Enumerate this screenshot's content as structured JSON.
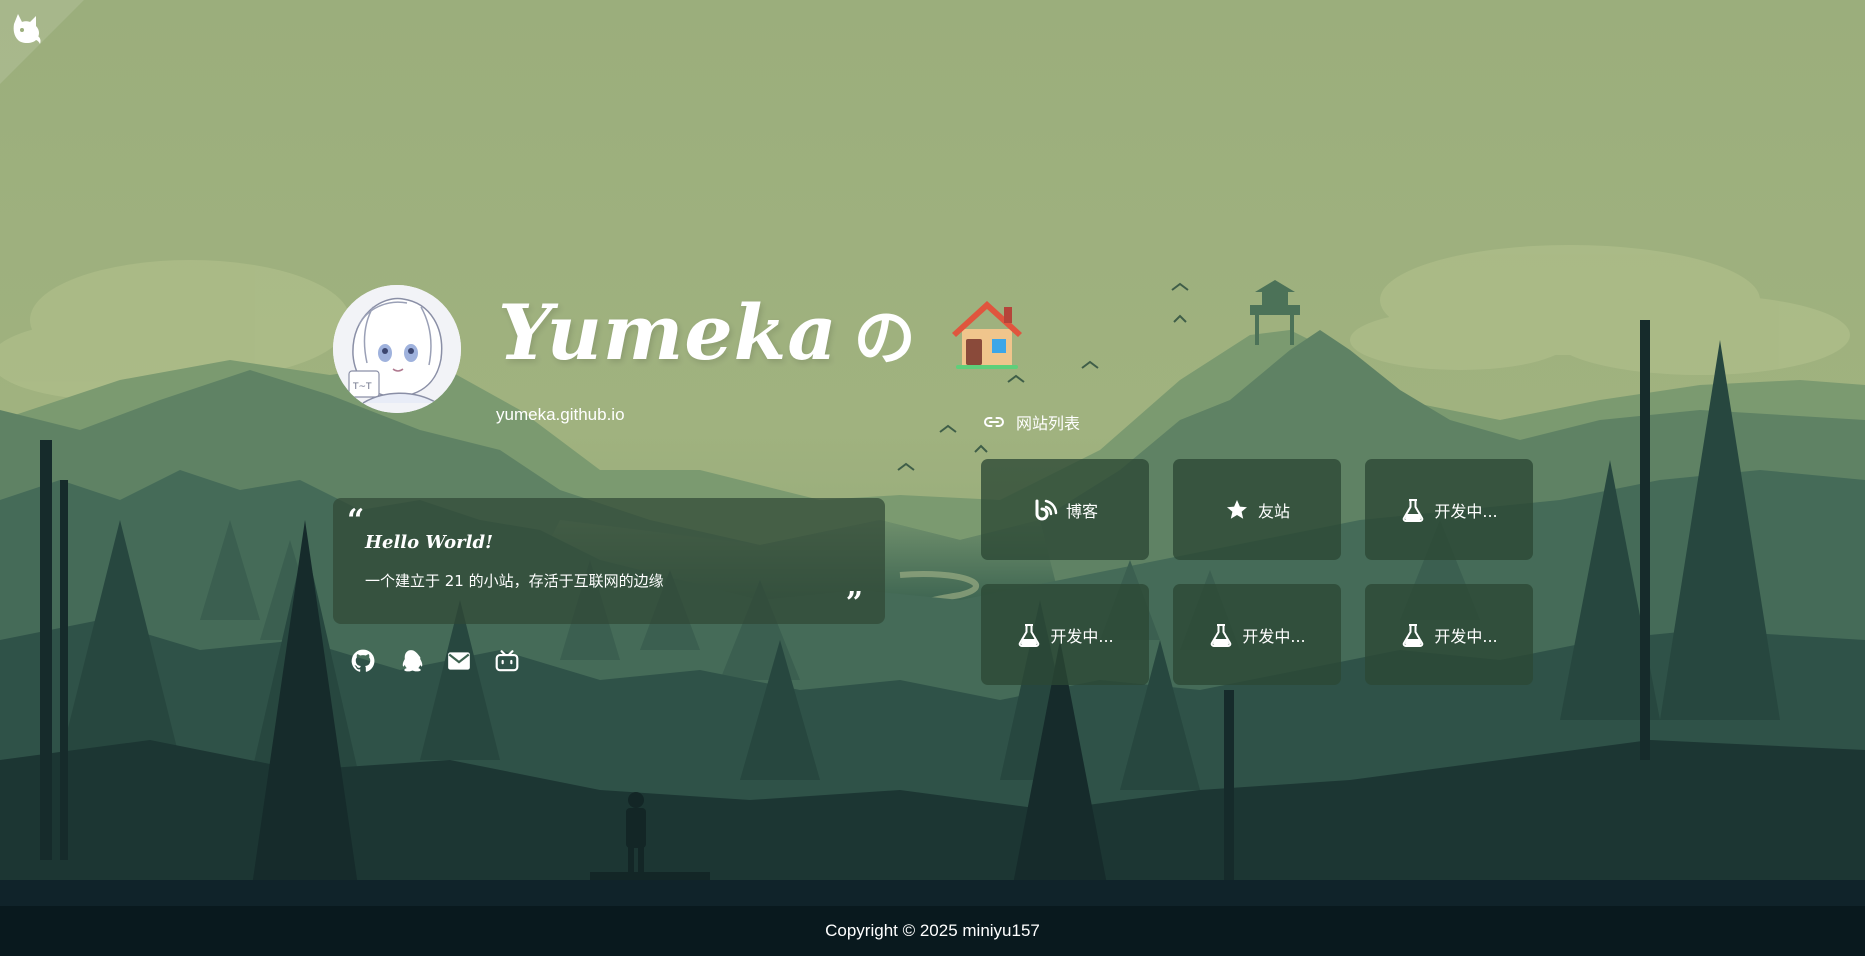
{
  "brand": {
    "corner_logo_icon": "fox-logo-icon"
  },
  "profile": {
    "name": "Yumeka",
    "possessive": "の",
    "home_icon": "house-emoji-icon",
    "url": "yumeka.github.io",
    "avatar_icon": "anime-avatar-illustration"
  },
  "quote": {
    "open_mark": "“",
    "title": "Hello World!",
    "text": "一个建立于 21 的小站，存活于互联网的边缘",
    "close_mark": "”"
  },
  "socials": [
    {
      "icon": "github-icon"
    },
    {
      "icon": "qq-icon"
    },
    {
      "icon": "email-icon"
    },
    {
      "icon": "bilibili-icon"
    }
  ],
  "site_list": {
    "header_icon": "link-icon",
    "title": "网站列表",
    "items": [
      {
        "icon": "blog-icon",
        "label": "博客"
      },
      {
        "icon": "star-icon",
        "label": "友站"
      },
      {
        "icon": "flask-icon",
        "label": "开发中..."
      },
      {
        "icon": "flask-icon",
        "label": "开发中..."
      },
      {
        "icon": "flask-icon",
        "label": "开发中..."
      },
      {
        "icon": "flask-icon",
        "label": "开发中..."
      }
    ]
  },
  "footer": {
    "copyright": "Copyright © 2025 miniyu157"
  },
  "colors": {
    "sky": "#9caf7d",
    "card_bg": "#2c4834",
    "text": "#ffffff"
  }
}
